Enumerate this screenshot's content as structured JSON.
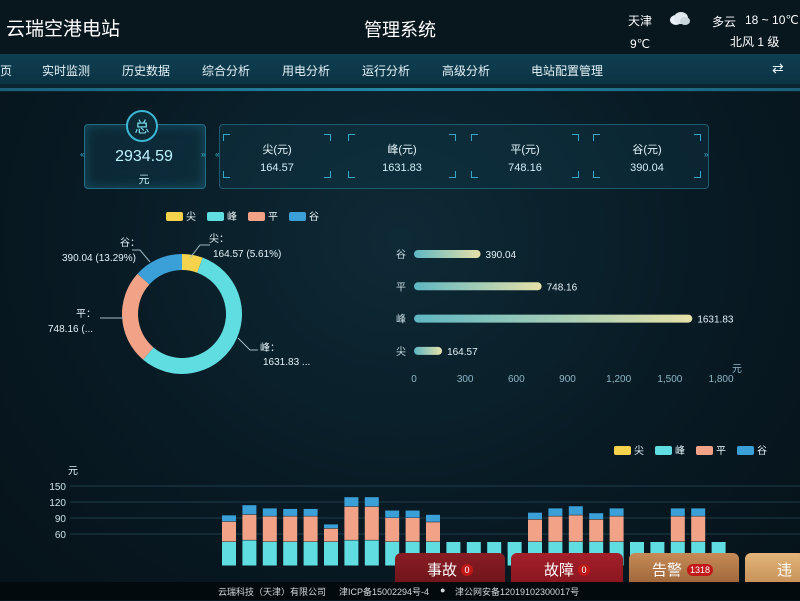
{
  "header": {
    "app_title": "云瑞空港电站",
    "system_title": "管理系统",
    "weather": {
      "city": "天津",
      "temp": "9℃",
      "condition": "多云",
      "range": "18 ~ 10℃",
      "wind": "北风 1 级",
      "icon": "cloudy-icon"
    }
  },
  "nav": {
    "items": [
      "页",
      "实时监测",
      "历史数据",
      "综合分析",
      "用电分析",
      "运行分析",
      "高级分析",
      "电站配置管理"
    ],
    "switch_icon": "swap-icon"
  },
  "summary": {
    "badge": "总",
    "total": "2934.59",
    "unit": "元",
    "cards": [
      {
        "label": "尖(元)",
        "value": "164.57"
      },
      {
        "label": "峰(元)",
        "value": "1631.83"
      },
      {
        "label": "平(元)",
        "value": "748.16"
      },
      {
        "label": "谷(元)",
        "value": "390.04"
      }
    ]
  },
  "colors": {
    "jian": "#f5d34c",
    "feng": "#5fdde0",
    "ping": "#f2a286",
    "gu": "#3b9fd8",
    "accent": "#2aa1c4"
  },
  "legend": [
    "尖",
    "峰",
    "平",
    "谷"
  ],
  "chart_data": [
    {
      "type": "pie",
      "categories": [
        "尖",
        "峰",
        "平",
        "谷"
      ],
      "values": [
        164.57,
        1631.83,
        748.16,
        390.04
      ],
      "labels": [
        {
          "name": "尖：",
          "text": "164.57  (5.61%)"
        },
        {
          "name": "峰：",
          "text": "1631.83  ..."
        },
        {
          "name": "平：",
          "text": "748.16  (..."
        },
        {
          "name": "谷：",
          "text": "390.04  (13.29%)"
        }
      ]
    },
    {
      "type": "bar",
      "orientation": "horizontal",
      "categories": [
        "谷",
        "平",
        "峰",
        "尖"
      ],
      "values": [
        390.04,
        748.16,
        1631.83,
        164.57
      ],
      "value_labels": [
        "390.04",
        "748.16",
        "1631.83",
        "164.57"
      ],
      "xlim": [
        0,
        1800
      ],
      "ticks": [
        "0",
        "300",
        "600",
        "900",
        "1,200",
        "1,500",
        "1,800"
      ],
      "unit": "元"
    },
    {
      "type": "bar",
      "stacked": true,
      "ylim": [
        0,
        150
      ],
      "yticks": [
        "150",
        "120",
        "90",
        "60"
      ],
      "ylabel": "元",
      "series": [
        {
          "name": "尖",
          "values": [
            0,
            0,
            0,
            0,
            0,
            0,
            0,
            0,
            0,
            0,
            0,
            0,
            0,
            0,
            0,
            0,
            0,
            0,
            0,
            0,
            0,
            0,
            0,
            0,
            0
          ]
        },
        {
          "name": "峰",
          "values": [
            45,
            48,
            45,
            45,
            45,
            45,
            48,
            48,
            45,
            45,
            45,
            45,
            45,
            45,
            45,
            45,
            45,
            45,
            45,
            45,
            45,
            45,
            45,
            45,
            45
          ]
        },
        {
          "name": "平",
          "values": [
            38,
            48,
            48,
            48,
            48,
            25,
            63,
            63,
            45,
            45,
            37,
            0,
            0,
            0,
            0,
            42,
            48,
            50,
            42,
            48,
            0,
            0,
            48,
            48,
            0
          ]
        },
        {
          "name": "谷",
          "values": [
            12,
            18,
            15,
            14,
            14,
            8,
            18,
            18,
            14,
            14,
            14,
            0,
            0,
            0,
            0,
            13,
            15,
            17,
            12,
            15,
            0,
            0,
            15,
            15,
            0
          ]
        }
      ]
    }
  ],
  "alarms": [
    {
      "label": "事故",
      "count": "0"
    },
    {
      "label": "故障",
      "count": "0"
    },
    {
      "label": "告警",
      "count": "1318"
    },
    {
      "label": "违规",
      "count": ""
    }
  ],
  "footer": {
    "company": "云瑞科技（天津）有限公司",
    "icp": "津ICP备15002294号-4",
    "police": "津公网安备12019102300017号"
  }
}
